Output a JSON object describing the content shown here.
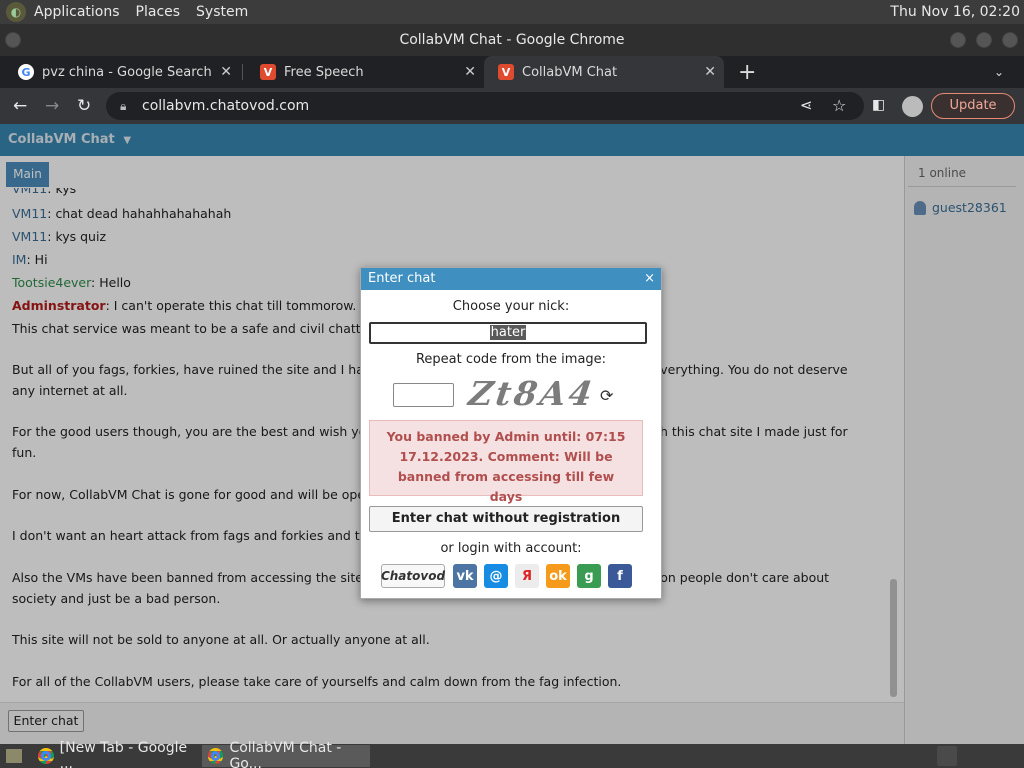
{
  "panel": {
    "applications": "Applications",
    "places": "Places",
    "system": "System",
    "clock": "Thu Nov 16, 02:20"
  },
  "window": {
    "title": "CollabVM Chat - Google Chrome"
  },
  "tabs": [
    {
      "label": "pvz china - Google Search",
      "icon": "google-icon"
    },
    {
      "label": "Free Speech",
      "icon": "chatovod-icon"
    },
    {
      "label": "CollabVM Chat",
      "icon": "chatovod-icon",
      "active": true
    }
  ],
  "toolbar": {
    "url": "collabvm.chatovod.com",
    "update_label": "Update",
    "new_tab_symbol": "+"
  },
  "chat": {
    "header_title": "CollabVM Chat",
    "main_tab": "Main",
    "messages": [
      {
        "nick": "VM11",
        "sep": ": ",
        "text": "kys",
        "kind": "user"
      },
      {
        "nick": "VM11",
        "sep": ": ",
        "text": "chat dead hahahhahahahah",
        "kind": "user"
      },
      {
        "nick": "VM11",
        "sep": ": ",
        "text": "kys quiz",
        "kind": "user"
      },
      {
        "nick": "IM",
        "sep": ": ",
        "text": "Hi",
        "kind": "user"
      },
      {
        "nick": "Tootsie4ever",
        "sep": ": ",
        "text": "Hello",
        "kind": "green"
      },
      {
        "nick": "Adminstrator",
        "sep": ": ",
        "text": "I can't operate this chat till tommorow.",
        "kind": "admin"
      }
    ],
    "paragraphs": [
      "This chat service was meant to be a safe and civil chatting su",
      "But all of you fags, forkies, have ruined the site and I have di                                                            nd everything. You do not deserve any internet at all.",
      "For the good users though, you are the best and wish you go                                                               ugh this chat site I made just for fun.",
      "For now, CollabVM Chat is gone for good and will be operati",
      "I don't want an heart attack from fags and forkies and the ba",
      "Also the VMs have been banned from accessing the site for                                                                eason people don't care about society and just be a bad person.",
      "This site will not be sold to anyone at all. Or actually anyone at all.",
      "For all of the CollabVM users, please take care of yourselfs and calm down from the fag infection."
    ],
    "enter_chat_label": "Enter chat",
    "online_count": "1 online",
    "online_user": "guest28361"
  },
  "dialog": {
    "title": "Enter chat",
    "close_symbol": "×",
    "choose_nick_label": "Choose your nick:",
    "nick_value": "hater",
    "repeat_code_label": "Repeat code from the image:",
    "captcha_text": "Zt8A4",
    "ban_message": "You banned by Admin until: 07:15 17.12.2023. Comment: Will be banned from accessing till few days",
    "enter_without_registration": "Enter chat without registration",
    "or_login_label": "or login with account:",
    "social_logins": [
      {
        "name": "Chatovod",
        "icon": "chatovod-login-icon"
      },
      {
        "name": "VK",
        "label": "vk",
        "color": "#4c75a3"
      },
      {
        "name": "Mail.ru",
        "label": "@",
        "color": "#168de2"
      },
      {
        "name": "Yandex",
        "label": "Я",
        "color": "#e8e8e8"
      },
      {
        "name": "Odnoklassniki",
        "label": "ok",
        "color": "#f59a1a"
      },
      {
        "name": "Google",
        "label": "g",
        "color": "#3a9b52"
      },
      {
        "name": "Facebook",
        "label": "f",
        "color": "#3b5998"
      }
    ]
  },
  "taskbar": {
    "items": [
      {
        "label": "[New Tab - Google ..."
      },
      {
        "label": "CollabVM Chat - Go...",
        "active": true
      }
    ]
  }
}
